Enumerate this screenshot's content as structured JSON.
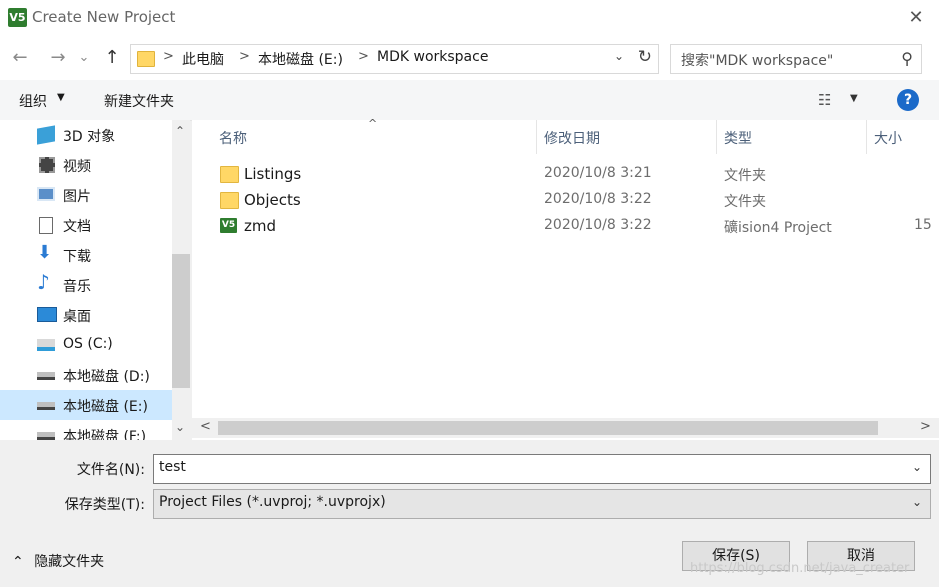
{
  "window": {
    "title": "Create New Project",
    "close_glyph": "✕",
    "app_icon_text": "V5"
  },
  "nav": {
    "back": "←",
    "forward": "→",
    "recent": "⌄",
    "up": "↑"
  },
  "address": {
    "crumbs": [
      "此电脑",
      "本地磁盘 (E:)",
      "MDK workspace"
    ],
    "separator": ">",
    "dropdown": "⌄",
    "refresh": "↻"
  },
  "search": {
    "placeholder": "搜索\"MDK workspace\"",
    "icon": "⚲"
  },
  "toolbar": {
    "organize": "组织",
    "organize_caret": "▼",
    "new_folder": "新建文件夹",
    "view_icon": "☷",
    "view_caret": "▼",
    "help": "?"
  },
  "sidebar": {
    "items": [
      {
        "label": "3D 对象",
        "icon": "cube-3d-icon"
      },
      {
        "label": "视频",
        "icon": "video-icon"
      },
      {
        "label": "图片",
        "icon": "pictures-icon"
      },
      {
        "label": "文档",
        "icon": "documents-icon"
      },
      {
        "label": "下载",
        "icon": "download-icon"
      },
      {
        "label": "音乐",
        "icon": "music-icon"
      },
      {
        "label": "桌面",
        "icon": "desktop-icon"
      },
      {
        "label": "OS (C:)",
        "icon": "system-drive-icon"
      },
      {
        "label": "本地磁盘 (D:)",
        "icon": "drive-icon"
      },
      {
        "label": "本地磁盘 (E:)",
        "icon": "drive-icon",
        "selected": true
      },
      {
        "label": "本地磁盘 (F:)",
        "icon": "drive-icon"
      }
    ],
    "scroll_up": "⌃",
    "scroll_down": "⌄"
  },
  "columns": {
    "name": "名称",
    "modified": "修改日期",
    "type": "类型",
    "size": "大小",
    "sort_glyph": "^"
  },
  "files": [
    {
      "name": "Listings",
      "modified": "2020/10/8 3:21",
      "type": "文件夹",
      "size": "",
      "icon": "folder-icon"
    },
    {
      "name": "Objects",
      "modified": "2020/10/8 3:22",
      "type": "文件夹",
      "size": "",
      "icon": "folder-icon"
    },
    {
      "name": "zmd",
      "modified": "2020/10/8 3:22",
      "type": "礦ision4 Project",
      "size": "15",
      "icon": "uvision-project-icon"
    }
  ],
  "hscroll": {
    "left": "<",
    "right": ">"
  },
  "form": {
    "filename_label": "文件名(N):",
    "filename_value": "test",
    "filetype_label": "保存类型(T):",
    "filetype_value": "Project Files (*.uvproj; *.uvprojx)",
    "dropdown": "⌄",
    "hide_folders": "隐藏文件夹",
    "hide_caret": "⌃",
    "save": "保存(S)",
    "cancel": "取消"
  },
  "watermark": "https://blog.csdn.net/java_creater"
}
